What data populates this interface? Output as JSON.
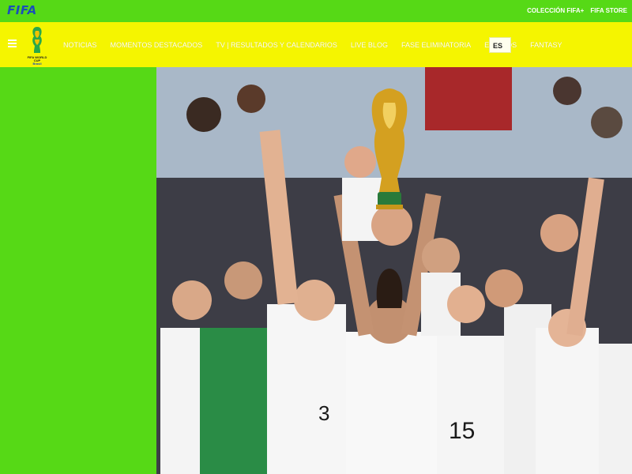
{
  "topbar": {
    "logo": "FIFA",
    "links": [
      "COLECCIÓN FIFA+",
      "FIFA STORE"
    ]
  },
  "navbar": {
    "logo_lines": [
      "FIFA WORLD CUP",
      "Brasil"
    ],
    "items": [
      "NOTICIAS",
      "MOMENTOS DESTACADOS",
      "TV | RESULTADOS Y CALENDARIOS",
      "LIVE BLOG",
      "FASE ELIMINATORIA",
      "EQUIPOS",
      "FANTASY"
    ],
    "language": "ES"
  },
  "hero": {
    "jersey_numbers": [
      "3",
      "15"
    ]
  },
  "colors": {
    "topbar_bg": "#56d916",
    "navbar_bg": "#f5f500",
    "left_panel_bg": "#56d916",
    "fifa_logo": "#1a4fb8"
  },
  "icons": [
    "menu-icon",
    "world-cup-logo-icon",
    "trophy-icon"
  ]
}
